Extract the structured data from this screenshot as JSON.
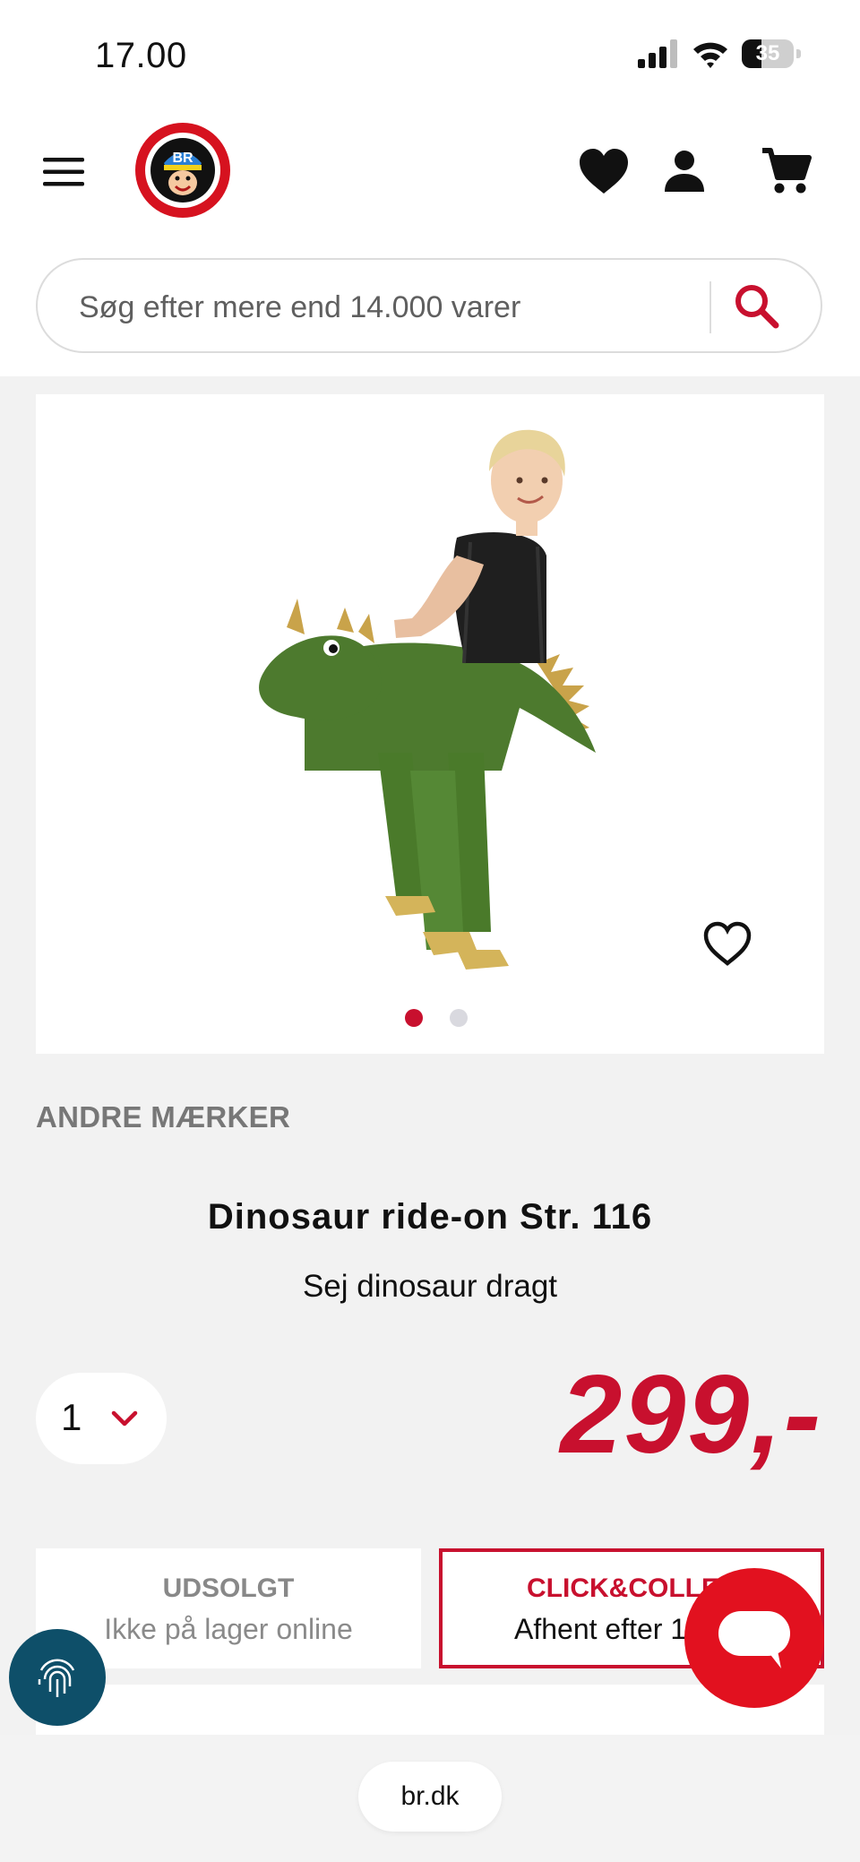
{
  "status_bar": {
    "time": "17.00",
    "battery": "35"
  },
  "header": {
    "menu_icon": "hamburger-menu-icon",
    "logo_text": "BR",
    "icons": [
      "heart-icon",
      "user-icon",
      "cart-icon"
    ]
  },
  "search": {
    "placeholder": "Søg efter mere end 14.000 varer",
    "button_icon": "search-icon"
  },
  "product": {
    "brand": "ANDRE MÆRKER",
    "title": "Dinosaur ride-on Str. 116",
    "subtitle": "Sej dinosaur dragt",
    "quantity": "1",
    "price": "299,-",
    "image_dots": {
      "count": 2,
      "active_index": 0
    }
  },
  "availability": {
    "online": {
      "title": "UDSOLGT",
      "detail": "Ikke på lager online"
    },
    "click_collect": {
      "title": "CLICK&COLLECT",
      "detail": "Afhent efter 1"
    }
  },
  "browser": {
    "url": "br.dk"
  },
  "colors": {
    "brand_red": "#c8102e",
    "chat_red": "#e2111f",
    "fingerprint_bg": "#0e4f69",
    "page_bg": "#f2f2f2"
  }
}
